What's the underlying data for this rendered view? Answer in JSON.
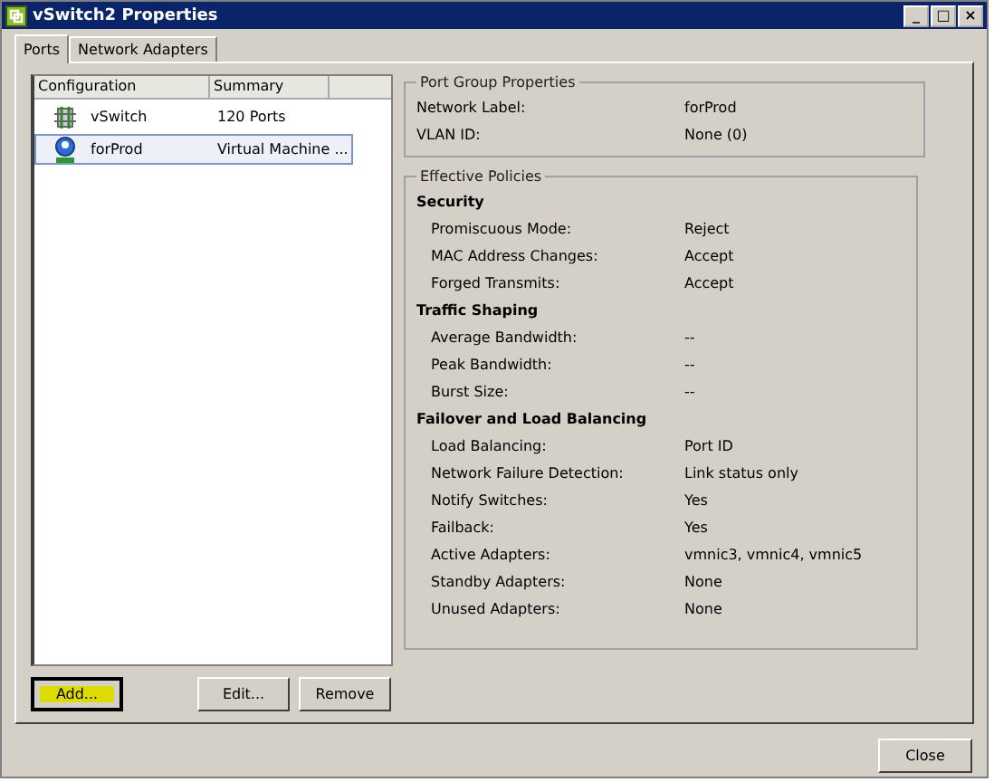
{
  "window": {
    "title": "vSwitch2 Properties",
    "controls": [
      "_",
      "□",
      "×"
    ]
  },
  "tabs": [
    {
      "label": "Ports",
      "selected": true
    },
    {
      "label": "Network Adapters",
      "selected": false
    }
  ],
  "ports_table": {
    "columns": [
      "Configuration",
      "Summary"
    ],
    "rows": [
      {
        "kind": "switch",
        "name": "vSwitch",
        "summary": "120 Ports",
        "selected": false
      },
      {
        "kind": "globe",
        "name": "forProd",
        "summary": "Virtual Machine ...",
        "selected": true
      }
    ]
  },
  "list_buttons": [
    {
      "label": "Add...",
      "highlighted": true
    },
    {
      "label": "Edit...",
      "highlighted": false
    },
    {
      "label": "Remove",
      "highlighted": false
    }
  ],
  "port_group_properties": {
    "title": "Port Group Properties",
    "rows": [
      {
        "label": "Network Label:",
        "value": "forProd"
      },
      {
        "label": "VLAN ID:",
        "value": "None (0)"
      }
    ]
  },
  "effective_policies": {
    "title": "Effective Policies",
    "sections": [
      {
        "heading": "Security",
        "rows": [
          {
            "label": "Promiscuous Mode:",
            "value": "Reject"
          },
          {
            "label": "MAC Address Changes:",
            "value": "Accept"
          },
          {
            "label": "Forged Transmits:",
            "value": "Accept"
          }
        ]
      },
      {
        "heading": "Traffic Shaping",
        "rows": [
          {
            "label": "Average Bandwidth:",
            "value": "--"
          },
          {
            "label": "Peak Bandwidth:",
            "value": "--"
          },
          {
            "label": "Burst Size:",
            "value": "--"
          }
        ]
      },
      {
        "heading": "Failover and Load Balancing",
        "rows": [
          {
            "label": "Load Balancing:",
            "value": "Port ID"
          },
          {
            "label": "Network Failure Detection:",
            "value": "Link status only"
          },
          {
            "label": "Notify Switches:",
            "value": "Yes"
          },
          {
            "label": "Failback:",
            "value": "Yes"
          },
          {
            "label": "Active Adapters:",
            "value": "vmnic3, vmnic4, vmnic5"
          },
          {
            "label": "Standby Adapters:",
            "value": "None"
          },
          {
            "label": "Unused Adapters:",
            "value": "None"
          }
        ]
      }
    ]
  },
  "footer_buttons": [
    "Close"
  ]
}
